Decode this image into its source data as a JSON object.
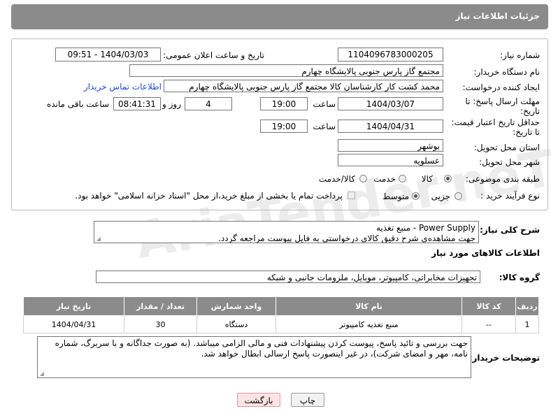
{
  "header": {
    "title": "جزئیات اطلاعات نیاز"
  },
  "form": {
    "need_number_label": "شماره نیاز:",
    "need_number": "1104096783000205",
    "announce_label": "تاریخ و ساعت اعلان عمومی:",
    "announce_value": "1404/03/03 - 09:51",
    "buyer_org_label": "نام دستگاه خریدار:",
    "buyer_org": "مجتمع گاز پارس جنوبی  پالایشگاه چهارم",
    "requester_label": "ایجاد کننده درخواست:",
    "requester": "محمد کشت کار کارشناسان کالا مجتمع گاز پارس جنوبی  پالایشگاه چهارم",
    "contact_link": "اطلاعات تماس خریدار",
    "reply_deadline_label_1": "مهلت ارسال پاسخ: تا",
    "reply_deadline_label_2": "تاریخ:",
    "reply_date": "1404/03/07",
    "time_label": "ساعت",
    "reply_time": "19:00",
    "days_value": "4",
    "days_label": "روز و",
    "remaining_time": "08:41:31",
    "remaining_label": "ساعت باقی مانده",
    "validity_label_1": "حداقل تاریخ اعتبار قیمت:",
    "validity_label_2": "تا تاریخ:",
    "validity_date": "1404/04/31",
    "validity_time": "19:00",
    "province_label": "استان محل تحویل:",
    "province": "بوشهر",
    "city_label": "شهر محل تحویل:",
    "city": "عسلویه",
    "category_label": "طبقه بندی موضوعی:",
    "category_options": [
      "کالا",
      "خدمت",
      "کالا/خدمت"
    ],
    "purchase_type_label": "نوع فرآیند خرید :",
    "purchase_options": [
      "جزیی",
      "متوسط"
    ],
    "payment_note": "پرداخت تمام یا بخشی از مبلغ خرید،از محل \"اسناد خزانه اسلامی\" خواهد بود."
  },
  "description": {
    "label": "شرح کلی نیاز:",
    "line1": "Power Supply - منبع تغذیه",
    "line2": "جهت مشاهده‌ی شرح دقیق کالای درخواستی به فایل پیوست مراجعه گردد."
  },
  "goods": {
    "section_title": "اطلاعات کالاهای مورد نیاز",
    "group_label": "گروه کالا:",
    "group_value": "تجهیزات مخابراتی، کامپیوتر، موبایل، ملزومات جانبی و شبکه",
    "columns": [
      "ردیف",
      "کد کالا",
      "نام کالا",
      "واحد شمارش",
      "تعداد / مقدار",
      "تاریخ نیاز"
    ],
    "rows": [
      [
        "1",
        "--",
        "منبع تغذیه کامپیوتر",
        "دستگاه",
        "30",
        "1404/04/31"
      ]
    ]
  },
  "buyer_notes": {
    "label": "توضیحات خریدار:",
    "text": "جهت بررسی و تائید پاسخ، پیوست کردن پیشنهادات فنی و مالی الزامی میباشد. (به صورت جداگانه و با سربرگ، شماره نامه، مهر و امضای شرکت)، در غیر اینصورت پاسخ ارسالی ابطال خواهد شد."
  },
  "buttons": {
    "print": "چاپ",
    "back": "بازگشت"
  },
  "watermark": "AriaTender.neT"
}
